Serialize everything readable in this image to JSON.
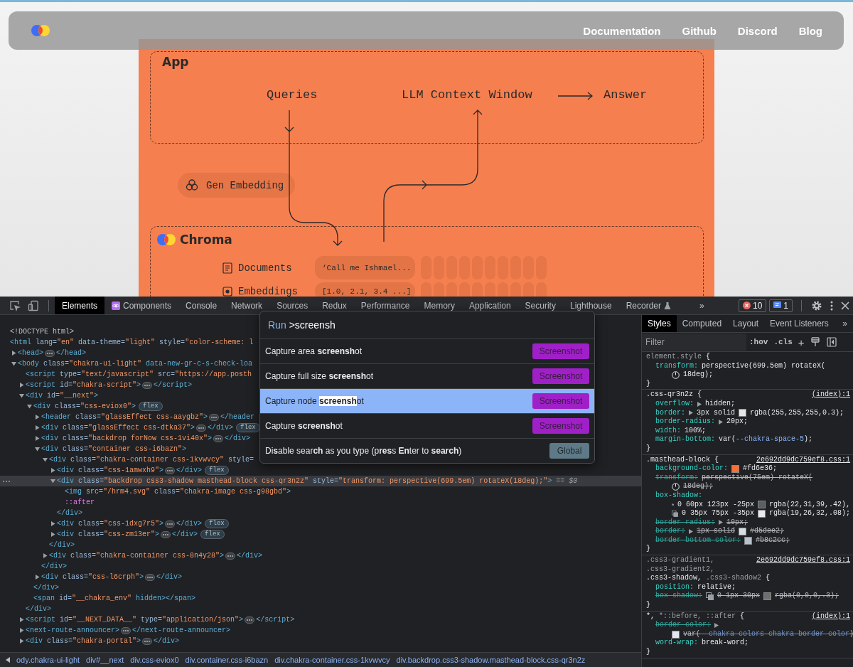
{
  "site": {
    "nav_links": [
      "Documentation",
      "Github",
      "Discord",
      "Blog"
    ],
    "masthead": {
      "app_label": "App",
      "flow": {
        "source": "Queries",
        "target": "LLM Context Window",
        "output": "Answer"
      },
      "embed_step": "Gen Embedding",
      "store": {
        "title": "Chroma",
        "rows": [
          {
            "kind": "documents",
            "label": "Documents",
            "value": "‘Call me Ishmael..."
          },
          {
            "kind": "embeddings",
            "label": "Embeddings",
            "value": "[1.0, 2.1, 3.4 ...]"
          }
        ]
      }
    }
  },
  "devtools": {
    "tabs": [
      {
        "label": "Elements",
        "kind": "plain",
        "selected": true
      },
      {
        "label": "Components",
        "kind": "components",
        "selected": false
      },
      {
        "label": "Console",
        "kind": "plain",
        "selected": false
      },
      {
        "label": "Network",
        "kind": "plain",
        "selected": false
      },
      {
        "label": "Sources",
        "kind": "plain",
        "selected": false
      },
      {
        "label": "Redux",
        "kind": "plain",
        "selected": false
      },
      {
        "label": "Performance",
        "kind": "plain",
        "selected": false
      },
      {
        "label": "Memory",
        "kind": "plain",
        "selected": false
      },
      {
        "label": "Application",
        "kind": "plain",
        "selected": false
      },
      {
        "label": "Security",
        "kind": "plain",
        "selected": false
      },
      {
        "label": "Lighthouse",
        "kind": "plain",
        "selected": false
      },
      {
        "label": "Recorder",
        "kind": "recorder",
        "selected": false
      }
    ],
    "more_tabs": "»",
    "errors": "10",
    "messages": "1",
    "elements": {
      "nodes": [
        {
          "kind": "doctype",
          "open": "<!DOCTYPE html>",
          "selected": false
        },
        {
          "kind": "root",
          "open": "<html lang=\"en\" data-theme=\"light\" style=\"color-scheme: l",
          "selected": false,
          "children": [
            {
              "kind": "element",
              "open": "<head>",
              "close": "</head>",
              "expanded": false,
              "selected": false
            },
            {
              "kind": "element",
              "open": "<body class=\"chakra-ui-light\" data-new-gr-c-s-check-loa",
              "expanded": true,
              "selected": false,
              "children": [
                {
                  "kind": "leaf",
                  "open": "<script type=\"text/javascript\" src=\"https://app.posth",
                  "selected": false
                },
                {
                  "kind": "element",
                  "open": "<script id=\"chakra-script\">",
                  "close": "</script>",
                  "expanded": false,
                  "selected": false
                },
                {
                  "kind": "element",
                  "open": "<div id=\"__next\">",
                  "close": "</div>",
                  "expanded": true,
                  "selected": false,
                  "children": [
                    {
                      "kind": "element",
                      "open": "<div class=\"css-eviox0\">",
                      "close": "</div>",
                      "badge": "flex",
                      "expanded": true,
                      "selected": false,
                      "children": [
                        {
                          "kind": "element",
                          "open": "<header class=\"glassEffect css-aaygbz\">",
                          "close": "</header",
                          "expanded": false,
                          "selected": false
                        },
                        {
                          "kind": "element",
                          "open": "<div class=\"glassEffect css-dtka37\">",
                          "close": "</div>",
                          "badge": "flex",
                          "expanded": false,
                          "selected": false
                        },
                        {
                          "kind": "element",
                          "open": "<div class=\"backdrop forNow css-1vi40x\">",
                          "close": "</div>",
                          "expanded": false,
                          "selected": false
                        },
                        {
                          "kind": "element",
                          "open": "<div class=\"container css-i6bazn\">",
                          "close": "</div>",
                          "expanded": true,
                          "selected": false,
                          "children": [
                            {
                              "kind": "element",
                              "open": "<div class=\"chakra-container css-1kvwvcy\" style=",
                              "close": "</div>",
                              "expanded": true,
                              "selected": false,
                              "children": [
                                {
                                  "kind": "element",
                                  "open": "<div class=\"css-1amwxh9\">",
                                  "close": "</div>",
                                  "badge": "flex",
                                  "expanded": false,
                                  "selected": false
                                },
                                {
                                  "kind": "element",
                                  "open": "<div class=\"backdrop css3-shadow masthead-block css-qr3n2z\" style=\"transform: perspective(699.5em) rotateX(18deg);\">",
                                  "close": "</div>",
                                  "marker": "== $0",
                                  "expanded": true,
                                  "selected": true,
                                  "children": [
                                    {
                                      "kind": "leaf",
                                      "open": "<img src=\"/hrm4.svg\" class=\"chakra-image css-g98gbd\">",
                                      "selected": false
                                    },
                                    {
                                      "kind": "pseudo",
                                      "open": "::after",
                                      "selected": false
                                    }
                                  ]
                                },
                                {
                                  "kind": "element",
                                  "open": "<div class=\"css-1dxg7r5\">",
                                  "close": "</div>",
                                  "badge": "flex",
                                  "expanded": false,
                                  "selected": false
                                },
                                {
                                  "kind": "element",
                                  "open": "<div class=\"css-zm13er\">",
                                  "close": "</div>",
                                  "badge": "flex",
                                  "expanded": false,
                                  "selected": false
                                }
                              ]
                            },
                            {
                              "kind": "element",
                              "open": "<div class=\"chakra-container css-8n4y28\">",
                              "close": "</div>",
                              "expanded": false,
                              "selected": false
                            }
                          ]
                        },
                        {
                          "kind": "element",
                          "open": "<div class=\"css-l6crph\">",
                          "close": "</div>",
                          "expanded": false,
                          "selected": false
                        }
                      ]
                    },
                    {
                      "kind": "leaf",
                      "open": "<span id=\"__chakra_env\" hidden></span>",
                      "selected": false
                    }
                  ]
                },
                {
                  "kind": "element",
                  "open": "<script id=\"__NEXT_DATA__\" type=\"application/json\">",
                  "close": "</script>",
                  "expanded": false,
                  "selected": false
                },
                {
                  "kind": "element",
                  "open": "<next-route-announcer>",
                  "close": "</next-route-announcer>",
                  "expanded": false,
                  "selected": false
                },
                {
                  "kind": "element",
                  "open": "<div class=\"chakra-portal\">",
                  "close": "</div>",
                  "expanded": false,
                  "selected": false
                }
              ]
            }
          ]
        }
      ]
    },
    "breadcrumbs": [
      "ody.chakra-ui-light",
      "div#__next",
      "div.css-eviox0",
      "div.container.css-i6bazn",
      "div.chakra-container.css-1kvwvcy",
      "div.backdrop.css3-shadow.masthead-block.css-qr3n2z"
    ],
    "command_menu": {
      "prompt": "Run",
      "query": ">screensh",
      "items": [
        {
          "kind": "command",
          "text": "Capture area **screensh**ot",
          "button": "Screenshot",
          "selected": false
        },
        {
          "kind": "command",
          "text": "Capture full size **screensh**ot",
          "button": "Screenshot",
          "selected": false
        },
        {
          "kind": "command",
          "text": "Capture node **screensh**ot",
          "button": "Screenshot",
          "selected": true
        },
        {
          "kind": "command",
          "text": "Capture **screensh**ot",
          "button": "Screenshot",
          "selected": false
        },
        {
          "kind": "setting",
          "text": "Di**s**able sear**ch** as you type (p**res**s **En**ter to **search**)",
          "button": "Global",
          "selected": false
        }
      ]
    },
    "styles": {
      "tabs": [
        {
          "label": "Styles",
          "selected": true
        },
        {
          "label": "Computed",
          "selected": false
        },
        {
          "label": "Layout",
          "selected": false
        },
        {
          "label": "Event Listeners",
          "selected": false
        }
      ],
      "more_tabs": "»",
      "filter_placeholder": "Filter",
      "hov": ":hov",
      "cls": ".cls",
      "add": "+",
      "rules": [
        {
          "selector_lines": [
            [
              {
                "text": "element.style",
                "matched": false
              }
            ]
          ],
          "open": "{",
          "close": "}",
          "declarations": [
            {
              "prop": "transform:",
              "struck": false,
              "parts": [
                {
                  "kind": "text",
                  "text": "perspective(699.5em) rotateX("
                },
                {
                  "kind": "break"
                },
                {
                  "kind": "angle"
                },
                {
                  "kind": "text",
                  "text": "18deg);"
                }
              ]
            }
          ]
        },
        {
          "selector_lines": [
            [
              {
                "text": ".css-qr3n2z",
                "matched": true
              }
            ]
          ],
          "source": "(index):1",
          "open": "{",
          "close": "}",
          "declarations": [
            {
              "prop": "overflow:",
              "struck": false,
              "parts": [
                {
                  "kind": "expander"
                },
                {
                  "kind": "text",
                  "text": "hidden;"
                }
              ]
            },
            {
              "prop": "border:",
              "struck": false,
              "parts": [
                {
                  "kind": "expander"
                },
                {
                  "kind": "text",
                  "text": "3px solid"
                },
                {
                  "kind": "swatch",
                  "color": "#e6e6e6"
                },
                {
                  "kind": "text",
                  "text": "rgba(255,255,255,0.3);"
                }
              ]
            },
            {
              "prop": "border-radius:",
              "struck": false,
              "parts": [
                {
                  "kind": "expander"
                },
                {
                  "kind": "text",
                  "text": "20px;"
                }
              ]
            },
            {
              "prop": "width:",
              "struck": false,
              "parts": [
                {
                  "kind": "text",
                  "text": "100%;"
                }
              ]
            },
            {
              "prop": "margin-bottom:",
              "struck": false,
              "parts": [
                {
                  "kind": "text",
                  "text": "var("
                },
                {
                  "kind": "var",
                  "text": "--chakra-space-5"
                },
                {
                  "kind": "text",
                  "text": ");"
                }
              ]
            }
          ]
        },
        {
          "selector_lines": [
            [
              {
                "text": ".masthead-block",
                "matched": true
              }
            ]
          ],
          "source": "2e692dd9dc759ef8.css:1",
          "open": "{",
          "close": "}",
          "declarations": [
            {
              "prop": "background-color:",
              "struck": false,
              "parts": [
                {
                  "kind": "swatch",
                  "color": "#fd6e36"
                },
                {
                  "kind": "text",
                  "text": "#fd6e36;"
                }
              ]
            },
            {
              "prop": "transform:",
              "struck": true,
              "parts": [
                {
                  "kind": "text",
                  "text": "perspective(75em) rotateX("
                },
                {
                  "kind": "break"
                },
                {
                  "kind": "angle"
                },
                {
                  "kind": "text",
                  "text": "18deg);"
                }
              ]
            },
            {
              "prop": "box-shadow:",
              "struck": false,
              "parts": [
                {
                  "kind": "break"
                },
                {
                  "kind": "shadow"
                },
                {
                  "kind": "text",
                  "text": "0 60px 123px -25px"
                },
                {
                  "kind": "swatch",
                  "color": "#5a5f63"
                },
                {
                  "kind": "text",
                  "text": "rgba(22,31,39,.42),"
                },
                {
                  "kind": "break"
                },
                {
                  "kind": "shadow"
                },
                {
                  "kind": "text",
                  "text": "0 35px 75px -35px"
                },
                {
                  "kind": "swatch",
                  "color": "#e9eaeb"
                },
                {
                  "kind": "text",
                  "text": "rgba(19,26,32,.08);"
                }
              ]
            },
            {
              "prop": "border-radius:",
              "struck": true,
              "parts": [
                {
                  "kind": "expander"
                },
                {
                  "kind": "text",
                  "text": "10px;"
                }
              ]
            },
            {
              "prop": "border:",
              "struck": true,
              "parts": [
                {
                  "kind": "expander"
                },
                {
                  "kind": "text",
                  "text": "1px solid"
                },
                {
                  "kind": "swatch",
                  "color": "#d5dee2"
                },
                {
                  "kind": "text",
                  "text": "#d5dee2;"
                }
              ]
            },
            {
              "prop": "border-bottom-color:",
              "struck": true,
              "parts": [
                {
                  "kind": "swatch",
                  "color": "#b8c2cc"
                },
                {
                  "kind": "text",
                  "text": "#b8c2cc;"
                }
              ]
            }
          ]
        },
        {
          "selector_lines": [
            [
              {
                "text": ".css3-gradient1,",
                "matched": false
              }
            ],
            [
              {
                "text": ".css3-gradient2,",
                "matched": false
              }
            ],
            [
              {
                "text": ".css3-shadow,",
                "matched": true
              },
              {
                "text": ".css3-shadow2",
                "matched": false
              }
            ]
          ],
          "source": "2e692dd9dc759ef8.css:1",
          "open": "{",
          "close": "}",
          "declarations": [
            {
              "prop": "position:",
              "struck": false,
              "parts": [
                {
                  "kind": "text",
                  "text": "relative;"
                }
              ]
            },
            {
              "prop": "box-shadow:",
              "struck": true,
              "parts": [
                {
                  "kind": "shadow"
                },
                {
                  "kind": "text",
                  "text": "0 1px 30px"
                },
                {
                  "kind": "swatch",
                  "color": "#6e6e6e"
                },
                {
                  "kind": "text",
                  "text": "rgba(0,0,0,.3);"
                }
              ]
            }
          ]
        },
        {
          "selector_lines": [
            [
              {
                "text": "*,",
                "matched": true
              },
              {
                "text": "*::before, ::after",
                "matched": false
              }
            ]
          ],
          "source": "(index):1",
          "open": "{",
          "close": "}",
          "declarations": [
            {
              "prop": "border-color:",
              "struck": true,
              "parts": [
                {
                  "kind": "expander"
                },
                {
                  "kind": "break"
                },
                {
                  "kind": "swatch",
                  "color": "#e2e8f0"
                },
                {
                  "kind": "text",
                  "text": "var("
                },
                {
                  "kind": "var",
                  "text": "--chakra-colors-chakra-border-color"
                },
                {
                  "kind": "text",
                  "text": ")"
                }
              ]
            },
            {
              "prop": "word-wrap:",
              "struck": false,
              "parts": [
                {
                  "kind": "text",
                  "text": "break-word;"
                }
              ]
            }
          ]
        }
      ]
    }
  }
}
